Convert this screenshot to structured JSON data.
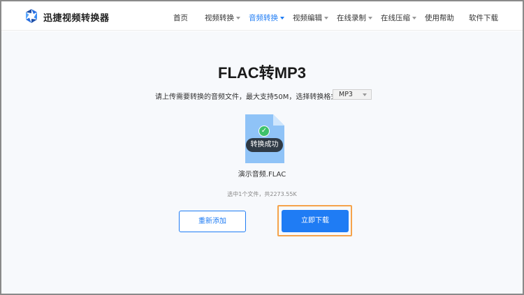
{
  "brand": {
    "name": "迅捷视频转换器"
  },
  "nav": {
    "items": [
      {
        "label": "首页",
        "has_dropdown": false,
        "active": false
      },
      {
        "label": "视频转换",
        "has_dropdown": true,
        "active": false
      },
      {
        "label": "音频转换",
        "has_dropdown": true,
        "active": true
      },
      {
        "label": "视频编辑",
        "has_dropdown": true,
        "active": false
      },
      {
        "label": "在线录制",
        "has_dropdown": true,
        "active": false
      },
      {
        "label": "在线压缩",
        "has_dropdown": true,
        "active": false
      },
      {
        "label": "使用帮助",
        "has_dropdown": false,
        "active": false
      },
      {
        "label": "软件下载",
        "has_dropdown": false,
        "active": false
      }
    ]
  },
  "main": {
    "title": "FLAC转MP3",
    "instruction": "请上传需要转换的音频文件，最大支持50M，选择转换格式:",
    "format_select": {
      "value": "MP3"
    },
    "file": {
      "status": "转换成功",
      "name": "演示音频.FLAC",
      "summary": "选中1个文件，共2273.55K"
    },
    "buttons": {
      "readd": "重新添加",
      "download": "立即下载"
    }
  },
  "colors": {
    "accent": "#1f7cf4",
    "success": "#3ec26b",
    "highlight": "#f5a34b",
    "badge_bg": "#2f3a45"
  }
}
